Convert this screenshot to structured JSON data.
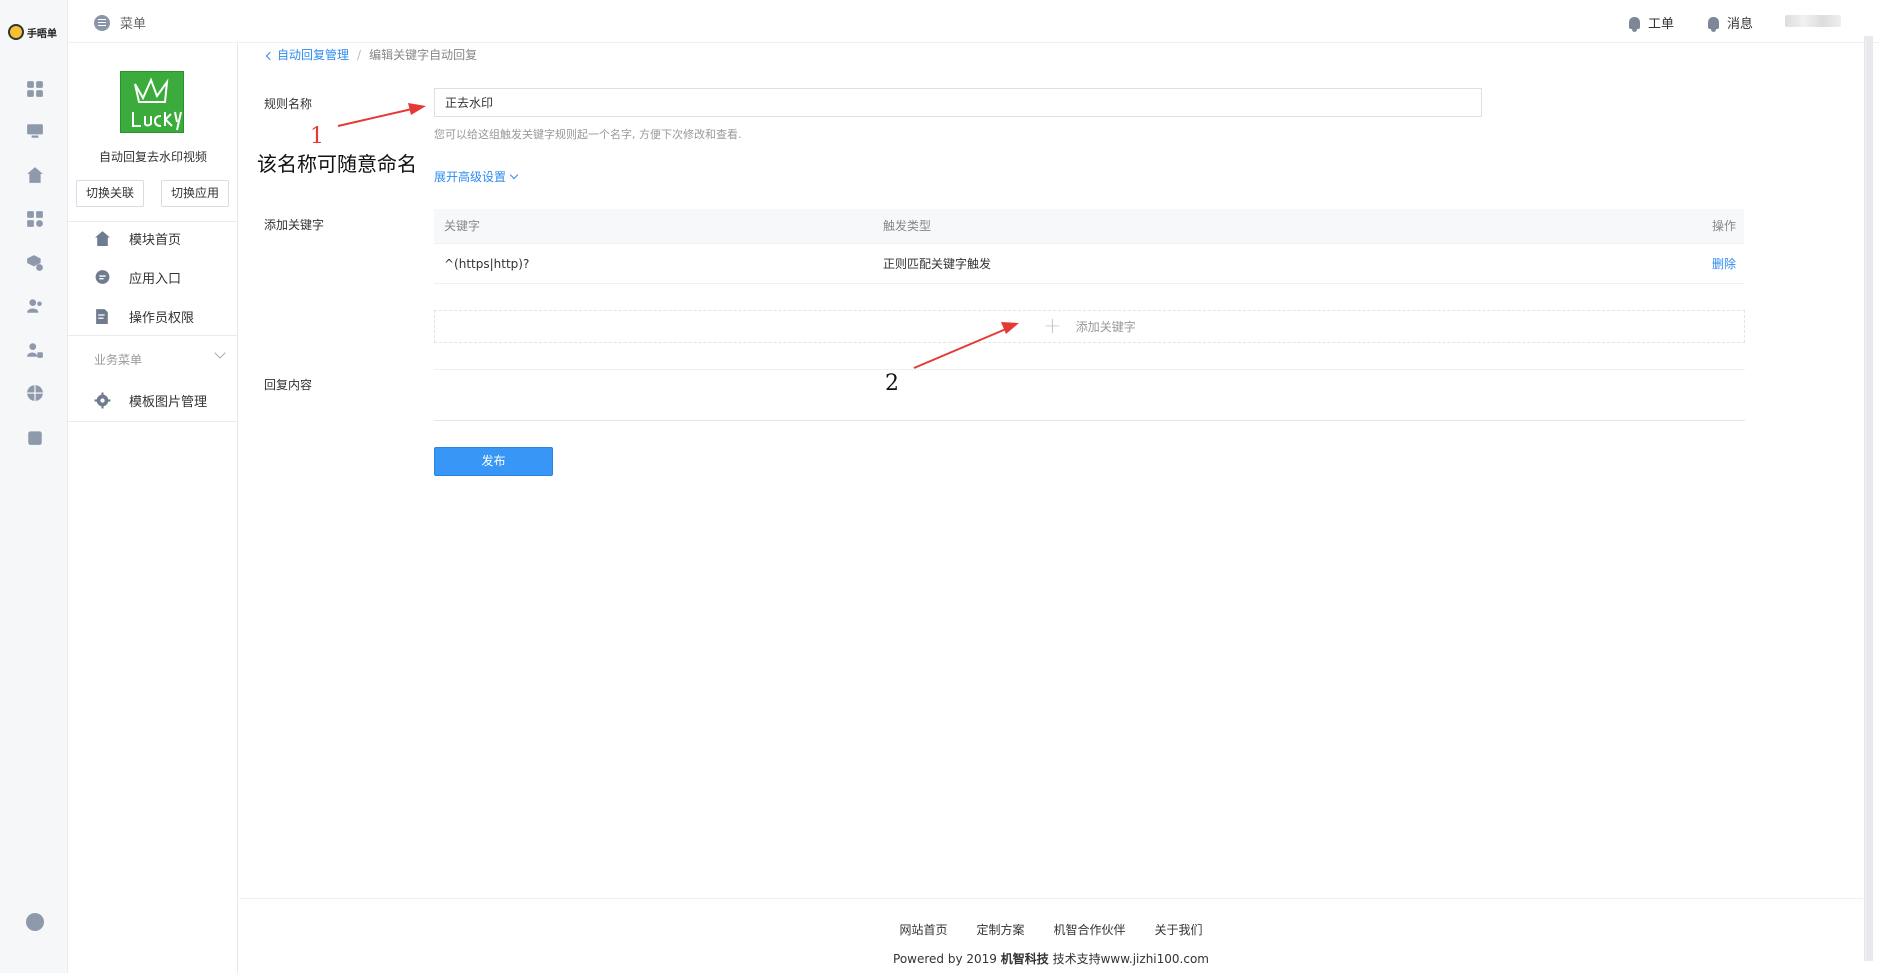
{
  "brand": {
    "logo_text": "手晤单"
  },
  "topbar": {
    "menu_label": "菜单",
    "work_order_label": "工单",
    "messages_label": "消息"
  },
  "sidebar": {
    "app_name": "自动回复去水印视频",
    "switch_link_label": "切换关联",
    "switch_app_label": "切换应用",
    "items": [
      {
        "label": "模块首页",
        "icon": "home-icon"
      },
      {
        "label": "应用入口",
        "icon": "chat-icon"
      },
      {
        "label": "操作员权限",
        "icon": "doc-edit-icon"
      }
    ],
    "section_title": "业务菜单",
    "section_items": [
      {
        "label": "模板图片管理",
        "icon": "gear-icon"
      }
    ]
  },
  "breadcrumb": {
    "parent": "自动回复管理",
    "separator": "/",
    "current": "编辑关键字自动回复"
  },
  "form": {
    "rule_name_label": "规则名称",
    "rule_name_value": "正去水印",
    "rule_name_hint": "您可以给这组触发关键字规则起一个名字, 方便下次修改和查看.",
    "expand_advanced": "展开高级设置",
    "add_keyword_label": "添加关键字",
    "reply_content_label": "回复内容",
    "publish_button": "发布"
  },
  "keyword_table": {
    "headers": {
      "keyword": "关键字",
      "trigger_type": "触发类型",
      "action": "操作"
    },
    "rows": [
      {
        "keyword": "^(https|http)?",
        "trigger_type": "正则匹配关键字触发",
        "action": "删除"
      }
    ],
    "add_keyword_button": "添加关键字"
  },
  "annotations": {
    "marker_1": "1",
    "marker_1_text": "该名称可随意命名",
    "marker_2": "2"
  },
  "footer": {
    "links": [
      "网站首页",
      "定制方案",
      "机智合作伙伴",
      "关于我们"
    ],
    "copyright_prefix": "Powered by 2019 ",
    "copyright_brand": "机智科技",
    "copyright_suffix": " 技术支持www.jizhi100.com"
  },
  "colors": {
    "accent": "#2d8cf0",
    "publish": "#3796f6",
    "annotation_arrow": "#e53935",
    "app_logo_bg": "#3bab3b"
  }
}
